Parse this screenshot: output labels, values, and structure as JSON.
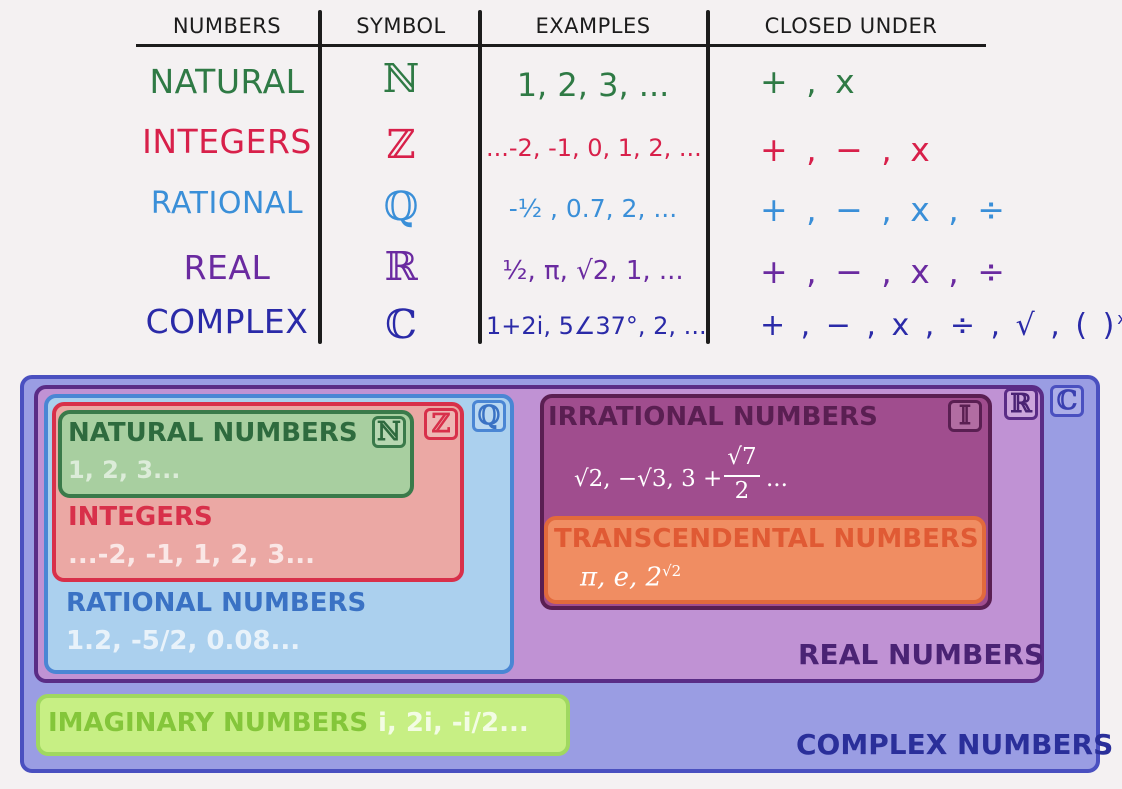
{
  "table": {
    "headers": [
      "NUMBERS",
      "SYMBOL",
      "EXAMPLES",
      "CLOSED UNDER"
    ],
    "rows": [
      {
        "name": "NATURAL",
        "symbol": "ℕ",
        "examples": "1, 2, 3, ...",
        "closed": "+ , x",
        "color": "#2f7a45"
      },
      {
        "name": "INTEGERS",
        "symbol": "ℤ",
        "examples": "...-2, -1, 0, 1, 2, ...",
        "closed": "+ , − , x",
        "color": "#d8204a"
      },
      {
        "name": "RATIONAL",
        "symbol": "ℚ",
        "examples": "-½ , 0.7, 2, ...",
        "closed": "+ , − , x , ÷",
        "color": "#3a8fd8"
      },
      {
        "name": "REAL",
        "symbol": "ℝ",
        "examples": "½, π, √2, 1, ...",
        "closed": "+ , − , x , ÷",
        "color": "#6a2aa0"
      },
      {
        "name": "COMPLEX",
        "symbol": "ℂ",
        "examples": "1+2i, 5∠37°, 2, ...",
        "closed": "+ , − , x , ÷ , √ , ( )",
        "closed_sup": "x",
        "color": "#2a2aa8"
      }
    ]
  },
  "diagram": {
    "complex": {
      "label": "COMPLEX NUMBERS",
      "tag": "ℂ",
      "color": "#2a2f9a",
      "fill": "#9a9de3"
    },
    "real": {
      "label": "REAL NUMBERS",
      "tag": "ℝ",
      "color": "#4a2374",
      "fill": "#c092d4"
    },
    "rational": {
      "label": "RATIONAL NUMBERS",
      "tag": "ℚ",
      "examples": "1.2, -5/2, 0.08...",
      "color": "#3a72c4",
      "fill": "#abd0ee"
    },
    "integers": {
      "label": "INTEGERS",
      "tag": "ℤ",
      "examples": "...-2, -1, 1, 2, 3...",
      "color": "#d8304a",
      "fill": "#eba8a4"
    },
    "natural": {
      "label": "NATURAL NUMBERS",
      "tag": "ℕ",
      "examples": "1, 2, 3...",
      "color": "#2e6b3e",
      "fill": "#a8cfa0"
    },
    "irrational": {
      "label": "IRRATIONAL NUMBERS",
      "tag": "𝕀",
      "color": "#5a1f52",
      "fill": "#a04d8e"
    },
    "transcendental": {
      "label": "TRANSCENDENTAL NUMBERS",
      "color": "#e05a34",
      "fill": "#f08d62"
    },
    "imaginary": {
      "label": "IMAGINARY NUMBERS",
      "examples": "i, 2i, -i/2...",
      "color": "#84c63a",
      "fill": "#c7ef84"
    }
  }
}
